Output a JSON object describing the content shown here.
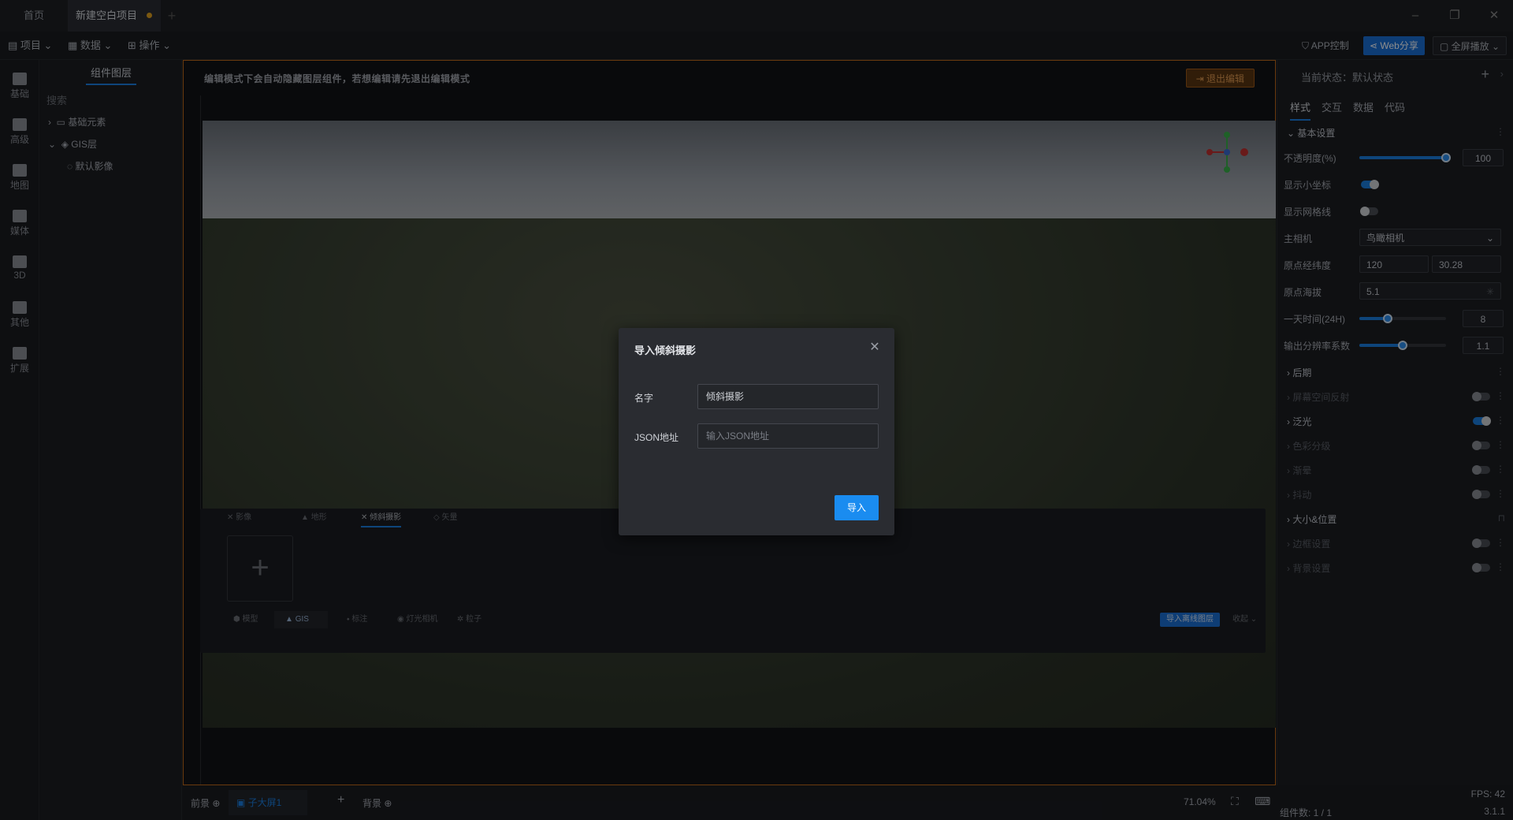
{
  "tabs": [
    {
      "label": "首页"
    },
    {
      "label": "新建空白项目",
      "modified": true
    }
  ],
  "toolbar": {
    "menus": [
      "项目",
      "数据",
      "操作"
    ],
    "app_control": "APP控制",
    "web_share": "Web分享",
    "fullscreen": "全屏播放"
  },
  "leftbar": [
    "基础",
    "高级",
    "地图",
    "媒体",
    "3D",
    "其他",
    "扩展"
  ],
  "layers": {
    "title": "组件图层",
    "search_placeholder": "搜索",
    "tree": [
      {
        "label": "基础元素",
        "level": 0,
        "expanded": false
      },
      {
        "label": "GIS层",
        "level": 0,
        "expanded": true
      },
      {
        "label": "默认影像",
        "level": 1
      }
    ]
  },
  "stage": {
    "hint": "编辑模式下会自动隐藏图层组件，若想编辑请先退出编辑模式",
    "exit_button": "退出编辑"
  },
  "bottom_panel": {
    "tabs": [
      "影像",
      "地形",
      "倾斜摄影",
      "矢量"
    ],
    "active_tab": "倾斜摄影",
    "categories": [
      "模型",
      "GIS",
      "标注",
      "灯光相机",
      "粒子"
    ],
    "import_button": "导入离线图层",
    "collapse": "收起"
  },
  "dialog": {
    "title": "导入倾斜摄影",
    "name_label": "名字",
    "name_value": "倾斜摄影",
    "json_label": "JSON地址",
    "json_placeholder": "输入JSON地址",
    "submit": "导入"
  },
  "right_panel": {
    "state_label": "当前状态：默认状态",
    "tabs": [
      "样式",
      "交互",
      "数据",
      "代码"
    ],
    "active_tab": "样式",
    "basic_section": "基本设置",
    "opacity": {
      "label": "不透明度(%)",
      "value": "100",
      "fraction": 1.0
    },
    "show_axis": {
      "label": "显示小坐标",
      "on": true
    },
    "show_grid": {
      "label": "显示网格线",
      "on": false
    },
    "camera": {
      "label": "主相机",
      "value": "鸟瞰相机"
    },
    "origin": {
      "label": "原点经纬度",
      "lng": "120",
      "lat": "30.28"
    },
    "altitude": {
      "label": "原点海拔",
      "value": "5.1"
    },
    "time": {
      "label": "一天时间(24H)",
      "value": "8",
      "fraction": 0.33
    },
    "resolution": {
      "label": "输出分辨率系数",
      "value": "1.1",
      "fraction": 0.5
    },
    "sections": [
      {
        "label": "后期",
        "dim": false,
        "toggle": null
      },
      {
        "label": "屏幕空间反射",
        "dim": true,
        "toggle": false
      },
      {
        "label": "泛光",
        "dim": false,
        "toggle": true
      },
      {
        "label": "色彩分级",
        "dim": true,
        "toggle": false
      },
      {
        "label": "渐晕",
        "dim": true,
        "toggle": false
      },
      {
        "label": "抖动",
        "dim": true,
        "toggle": false
      },
      {
        "label": "大小&位置",
        "dim": false,
        "toggle": null
      },
      {
        "label": "边框设置",
        "dim": true,
        "toggle": false
      },
      {
        "label": "背景设置",
        "dim": true,
        "toggle": false
      }
    ]
  },
  "statusbar": {
    "foreground": "前景",
    "screen_tab": "子大屏1",
    "background": "背景",
    "zoom": "71.04%",
    "fps": "FPS: 42",
    "component_count": "组件数: 1 / 1",
    "version": "3.1.1"
  },
  "colors": {
    "accent": "#1a7fe0",
    "warning": "#c26a1a",
    "primary_button": "#1a8cf0"
  }
}
